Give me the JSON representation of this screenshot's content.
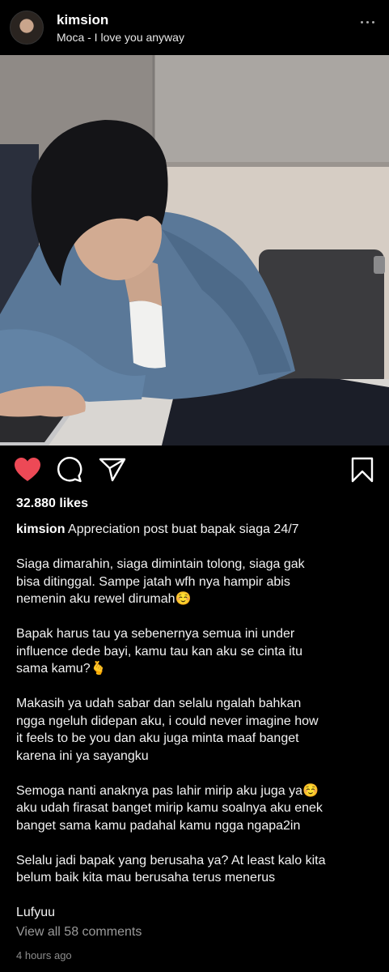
{
  "post": {
    "username": "kimsion",
    "audio": "Moca - I love you anyway",
    "likes": "32.880 likes",
    "caption_username": "kimsion",
    "caption_lines": [
      " Appreciation post buat bapak siaga 24/7",
      "",
      "Siaga dimarahin, siaga dimintain tolong, siaga gak",
      "bisa ditinggal. Sampe jatah wfh nya hampir abis",
      "nemenin aku rewel dirumah☺️",
      "",
      "Bapak harus tau ya sebenernya semua ini under",
      "influence dede bayi, kamu tau kan aku se cinta itu",
      "sama kamu?🫰",
      "",
      "Makasih ya udah sabar dan selalu ngalah bahkan",
      "ngga ngeluh didepan aku, i could never imagine how",
      "it feels to be you dan aku juga minta maaf banget",
      "karena ini ya sayangku",
      "",
      "Semoga nanti anaknya pas lahir mirip aku juga ya☺️",
      "aku udah firasat banget mirip kamu soalnya aku enek",
      "banget sama kamu padahal kamu ngga ngapa2in",
      "",
      "Selalu jadi bapak yang berusaha ya? At least kalo kita",
      "belum baik kita mau berusaha terus menerus",
      "",
      "Lufyuu"
    ],
    "view_comments": "View all 58 comments",
    "timestamp": "4 hours ago"
  },
  "icons": {
    "like": "heart-filled-icon",
    "comment": "comment-bubble-icon",
    "share": "paper-plane-icon",
    "save": "bookmark-icon",
    "more": "more-dots-icon"
  },
  "colors": {
    "background": "#000000",
    "like_red": "#ed4956",
    "text": "#f2f2f2",
    "muted": "#9a9a9a"
  }
}
